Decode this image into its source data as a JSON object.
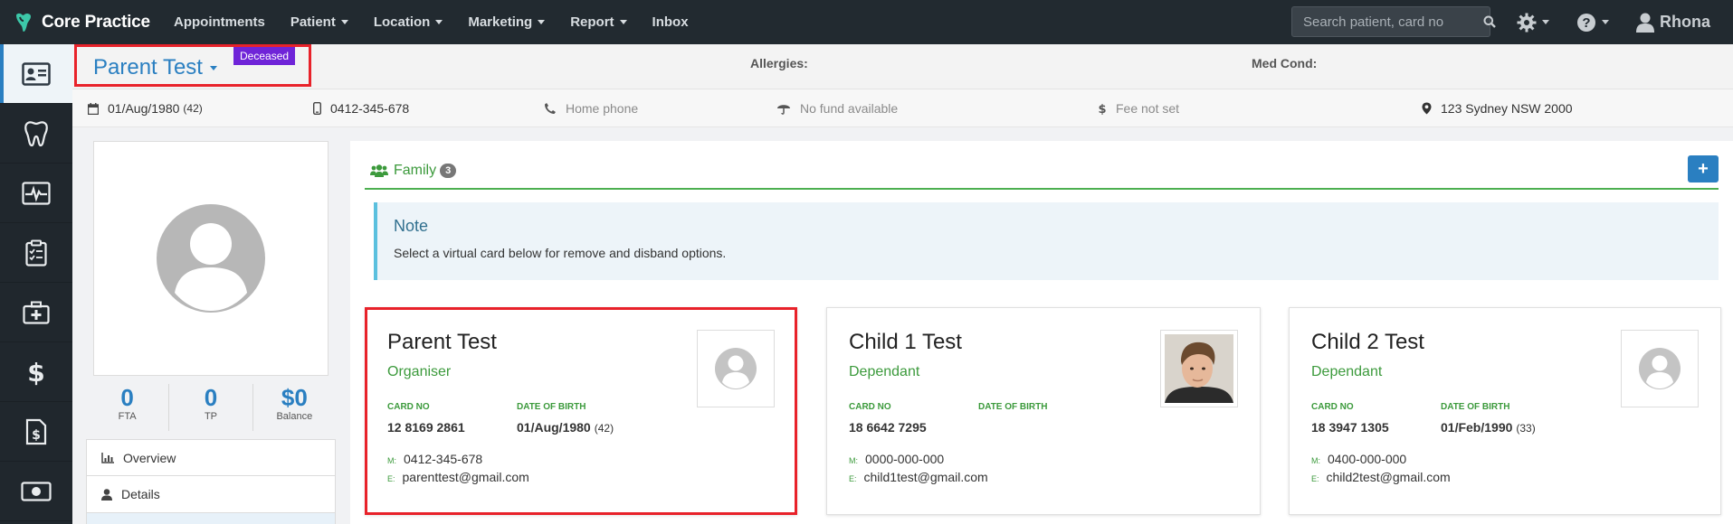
{
  "app": {
    "brand": "Core Practice",
    "menu": [
      {
        "label": "Appointments",
        "dropdown": false
      },
      {
        "label": "Patient",
        "dropdown": true
      },
      {
        "label": "Location",
        "dropdown": true
      },
      {
        "label": "Marketing",
        "dropdown": true
      },
      {
        "label": "Report",
        "dropdown": true
      },
      {
        "label": "Inbox",
        "dropdown": false
      }
    ],
    "search_placeholder": "Search patient, card no",
    "user": "Rhona",
    "colors": {
      "nav_bg": "#222a30",
      "accent": "#2a7fc1",
      "green": "#3c9a3c",
      "badge_purple": "#6f24d8",
      "highlight_red": "#e8222a"
    }
  },
  "sidebar": {
    "items": [
      "patient-card-icon",
      "tooth-icon",
      "heart-monitor-icon",
      "clipboard-icon",
      "medical-kit-icon",
      "dollar-icon",
      "invoice-icon",
      "money-icon"
    ],
    "active_index": 0
  },
  "patient": {
    "name": "Parent Test",
    "badge": "Deceased",
    "allergies_label": "Allergies:",
    "medcond_label": "Med Cond:",
    "dob": "01/Aug/1980",
    "age": "(42)",
    "mobile": "0412-345-678",
    "home_phone": "Home phone",
    "fund": "No fund available",
    "fee": "Fee not set",
    "address": "123 Sydney NSW 2000"
  },
  "stats": [
    {
      "value": "0",
      "label": "FTA"
    },
    {
      "value": "0",
      "label": "TP"
    },
    {
      "value": "$0",
      "label": "Balance"
    }
  ],
  "profile_nav": [
    {
      "label": "Overview",
      "icon": "chart-icon"
    },
    {
      "label": "Details",
      "icon": "user-icon"
    },
    {
      "label": "",
      "icon": ""
    }
  ],
  "family": {
    "title": "Family",
    "count": "3",
    "add_label": "+",
    "note_title": "Note",
    "note_text": "Select a virtual card below for remove and disband options.",
    "card_no_label": "CARD NO",
    "dob_label": "DATE OF BIRTH",
    "mobile_prefix": "M:",
    "email_prefix": "E:",
    "members": [
      {
        "name": "Parent Test",
        "role": "Organiser",
        "card_no": "12 8169 2861",
        "dob": "01/Aug/1980",
        "age": "(42)",
        "mobile": "0412-345-678",
        "email": "parenttest@gmail.com",
        "photo": "avatar-placeholder"
      },
      {
        "name": "Child 1 Test",
        "role": "Dependant",
        "card_no": "18 6642 7295",
        "dob": "",
        "age": "",
        "mobile": "0000-000-000",
        "email": "child1test@gmail.com",
        "photo": "boy-photo"
      },
      {
        "name": "Child 2 Test",
        "role": "Dependant",
        "card_no": "18 3947 1305",
        "dob": "01/Feb/1990",
        "age": "(33)",
        "mobile": "0400-000-000",
        "email": "child2test@gmail.com",
        "photo": "avatar-placeholder"
      }
    ]
  }
}
